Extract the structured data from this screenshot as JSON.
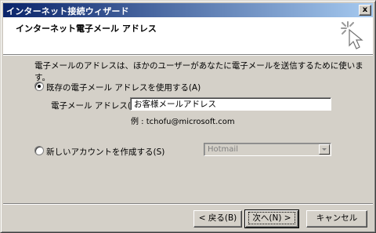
{
  "window": {
    "title": "インターネット接続ウィザード",
    "close_label": "x"
  },
  "header": {
    "title": "インターネット電子メール アドレス",
    "icon": "wizard-icon"
  },
  "description": "電子メールのアドレスは、ほかのユーザーがあなたに電子メールを送信するために使います。",
  "option_existing": {
    "label": "既存の電子メール アドレスを使用する(A)",
    "selected": true
  },
  "email": {
    "label": "電子メール アドレス(E):",
    "value": "お客様メールアドレス",
    "example": "例 : tchofu@microsoft.com"
  },
  "option_new": {
    "label": "新しいアカウントを作成する(S)",
    "selected": false
  },
  "provider_select": {
    "value": "Hotmail",
    "disabled": true
  },
  "buttons": {
    "back": "< 戻る(B)",
    "next": "次へ(N) >",
    "cancel": "キャンセル"
  }
}
